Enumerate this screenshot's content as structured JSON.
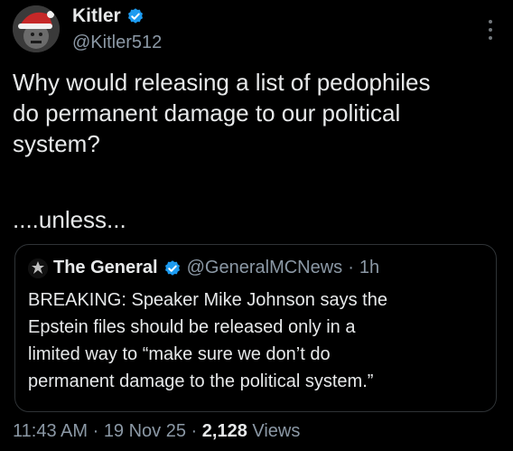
{
  "author": {
    "display_name": "Kitler",
    "handle": "@Kitler512",
    "avatar_icon": "santa-hat-avatar-icon",
    "verified_icon": "verified-badge-icon"
  },
  "tweet": {
    "text": "Why would releasing a list of pedophiles\ndo permanent damage to our political\nsystem?",
    "tail": "....unless..."
  },
  "quote": {
    "display_name": "The General",
    "handle": "@GeneralMCNews",
    "separator": "·",
    "time": "1h",
    "text": "BREAKING: Speaker Mike Johnson says the\nEpstein files should be released only in a\nlimited way to “make sure we don’t do\npermanent damage to the political system.”"
  },
  "meta": {
    "time": "11:43 AM",
    "sep1": " · ",
    "date": "19 Nov 25",
    "sep2": " · ",
    "views_count": "2,128",
    "views_label": " Views"
  },
  "colors": {
    "background": "#000000",
    "text": "#e7e9ea",
    "secondary": "#8b98a5",
    "verified": "#1d9bf0",
    "border": "#2f3336"
  }
}
